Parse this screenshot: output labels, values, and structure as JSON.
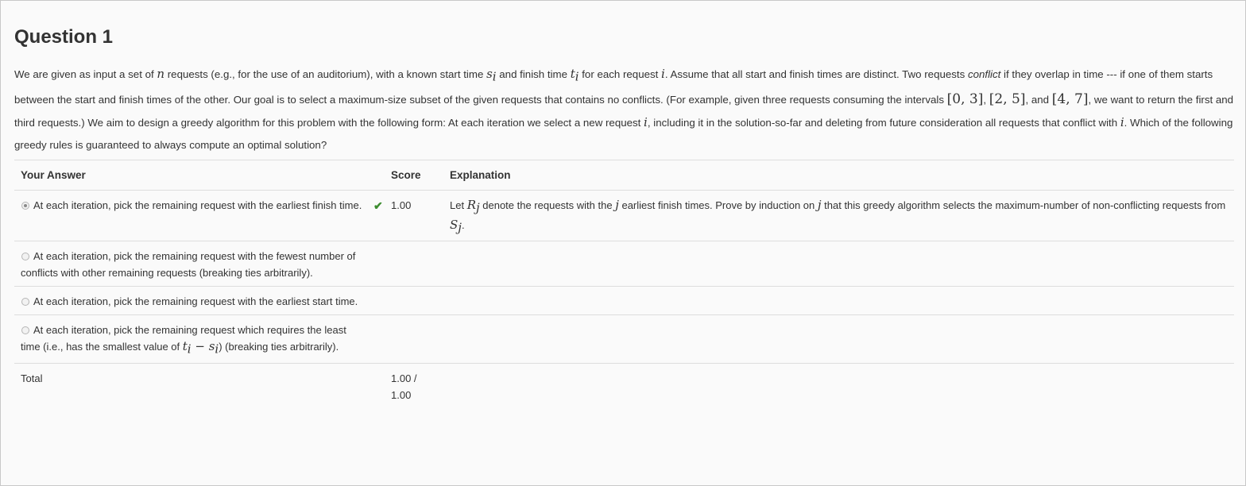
{
  "question": {
    "title": "Question 1",
    "text_1": "We are given as input a set of ",
    "var_n": "n",
    "text_2": " requests (e.g., for the use of an auditorium), with a known start time ",
    "var_s": "s",
    "sub_i": "i",
    "text_3": " and finish time ",
    "var_t": "t",
    "text_4": " for each request ",
    "var_i": "i",
    "text_5": ". Assume that all start and finish times are distinct. Two requests ",
    "conflict_word": "conflict",
    "text_6": " if they overlap in time --- if one of them starts between the start and finish times of the other. Our goal is to select a maximum-size subset of the given requests that contains no conflicts. (For example, given three requests consuming the intervals ",
    "interval_1": "[0, 3]",
    "sep_1": ", ",
    "interval_2": "[2, 5]",
    "sep_2": ", and ",
    "interval_3": "[4, 7]",
    "text_7": ", we want to return the first and third requests.) We aim to design a greedy algorithm for this problem with the following form: At each iteration we select a new request ",
    "text_8": ", including it in the solution-so-far and deleting from future consideration all requests that conflict with ",
    "text_9": ". Which of the following greedy rules is guaranteed to always compute an optimal solution?"
  },
  "table": {
    "headers": {
      "answer": "Your Answer",
      "score": "Score",
      "explanation": "Explanation"
    },
    "rows": [
      {
        "answer": "At each iteration, pick the remaining request with the earliest finish time.",
        "selected": true,
        "correct": true,
        "score": "1.00",
        "explanation": {
          "p1": "Let ",
          "var_R": "R",
          "sub_j": "j",
          "p2": " denote the requests with the ",
          "var_j": "j",
          "p3": " earliest finish times. Prove by induction on ",
          "p4": " that this greedy algorithm selects the maximum-number of non-conflicting requests from ",
          "var_S": "S",
          "p5": "."
        }
      },
      {
        "answer": "At each iteration, pick the remaining request with the fewest number of conflicts with other remaining requests (breaking ties arbitrarily).",
        "selected": false
      },
      {
        "answer": "At each iteration, pick the remaining request with the earliest start time.",
        "selected": false
      },
      {
        "answer_a": "At each iteration, pick the remaining request which requires the least time (i.e., has the smallest value of ",
        "math_t": "t",
        "math_i": "i",
        "math_minus": " − ",
        "math_s": "s",
        "answer_b": ") (breaking ties arbitrarily).",
        "selected": false
      }
    ],
    "total": {
      "label": "Total",
      "score": "1.00 / 1.00"
    }
  },
  "colors": {
    "check": "#3c8c2f",
    "text": "#333333",
    "border": "#dddddd"
  }
}
